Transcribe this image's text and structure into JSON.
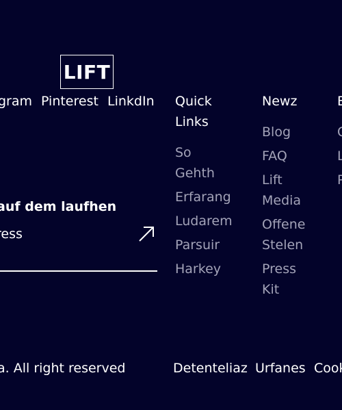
{
  "brand": {
    "logo_text": "LIFT"
  },
  "social": [
    "gram",
    "Pinterest",
    "LinkdIn"
  ],
  "columns": [
    {
      "heading": "Quick Links",
      "items": [
        "So Gehth",
        "Erfarang",
        "Ludarem",
        "Parsuir",
        "Harkey"
      ]
    },
    {
      "heading": "Newz",
      "items": [
        "Blog",
        "FAQ",
        "Lift Media",
        "Offene Stelen",
        "Press Kit"
      ]
    },
    {
      "heading": "E",
      "items": [
        "C",
        "L",
        "P"
      ]
    }
  ],
  "newsletter": {
    "title": "auf dem laufhen",
    "email_placeholder": "ress",
    "submit_icon": "arrow-up-right-icon"
  },
  "footer": {
    "copyright": "a. All right reserved",
    "links": [
      "Detenteliaz",
      "Urfanes",
      "Cook"
    ]
  },
  "colors": {
    "background": "#03032a",
    "text": "#ffffff",
    "muted": "#a3a3b8"
  }
}
